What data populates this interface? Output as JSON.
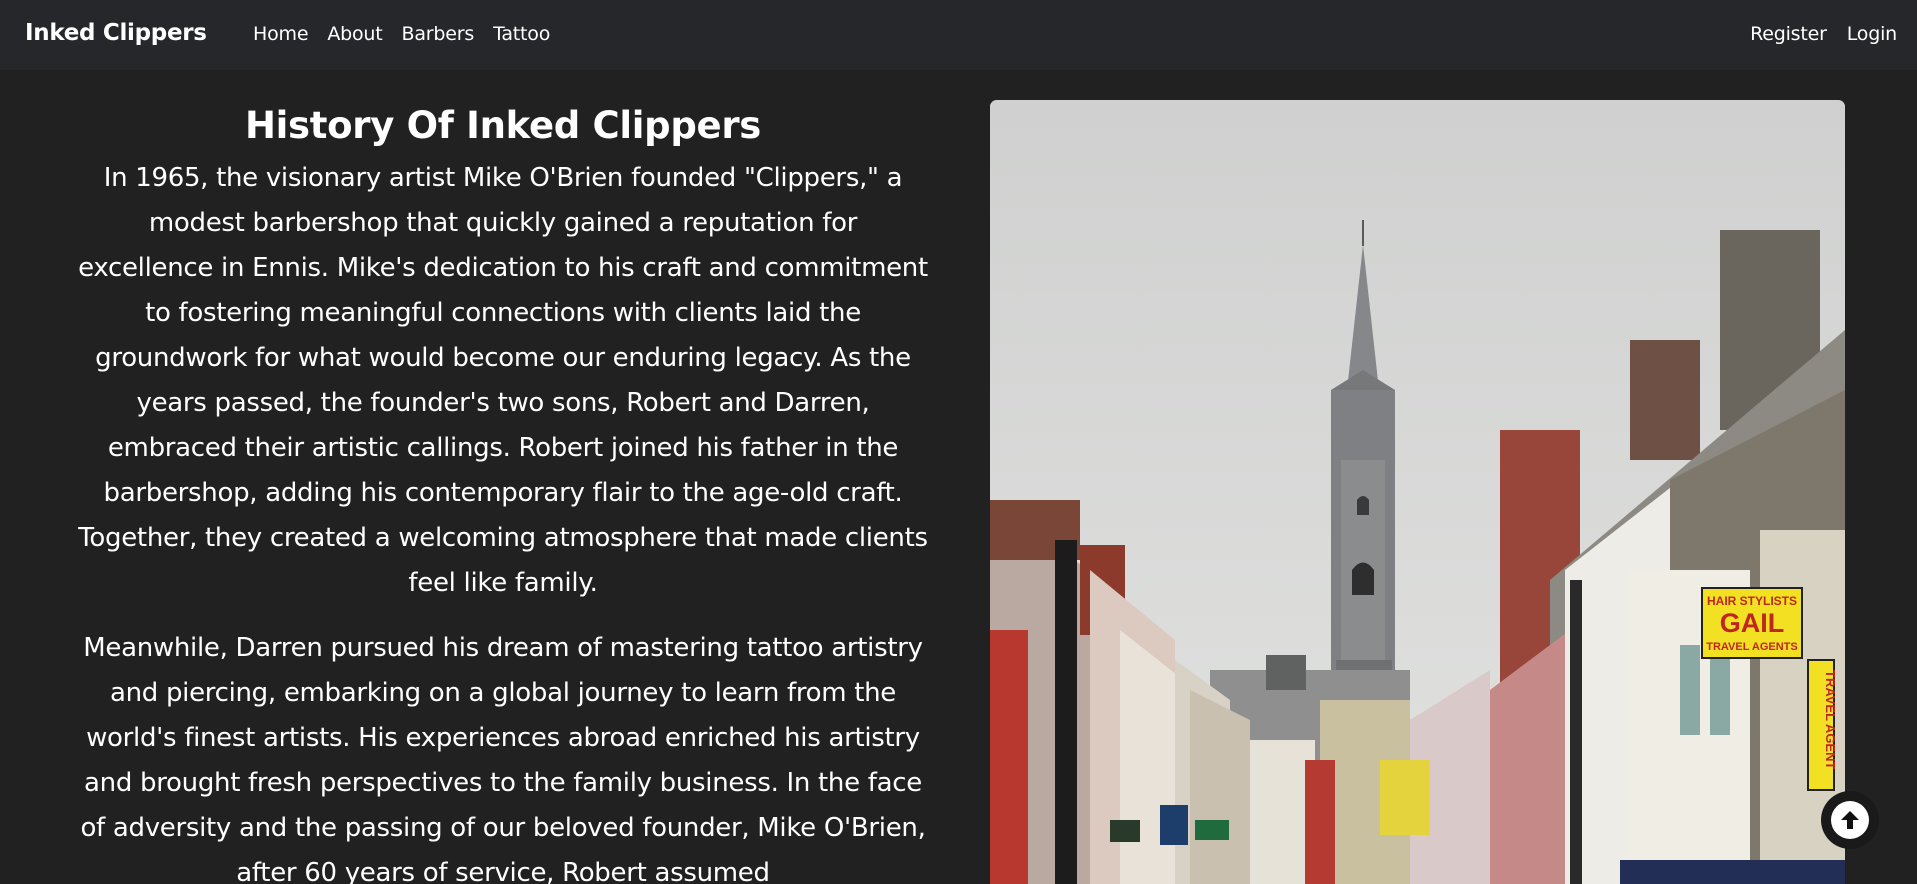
{
  "navbar": {
    "brand": "Inked Clippers",
    "links": [
      "Home",
      "About",
      "Barbers",
      "Tattoo"
    ],
    "auth": [
      "Register",
      "Login"
    ]
  },
  "history": {
    "title": "History Of Inked Clippers",
    "paragraph1": "In 1965, the visionary artist Mike O'Brien founded \"Clippers,\" a modest barbershop that quickly gained a reputation for excellence in Ennis. Mike's dedication to his craft and commitment to fostering meaningful connections with clients laid the groundwork for what would become our enduring legacy. As the years passed, the founder's two sons, Robert and Darren, embraced their artistic callings. Robert joined his father in the barbershop, adding his contemporary flair to the age-old craft. Together, they created a welcoming atmosphere that made clients feel like family.",
    "paragraph2": "Meanwhile, Darren pursued his dream of mastering tattoo artistry and piercing, embarking on a global journey to learn from the world's finest artists. His experiences abroad enriched his artistry and brought fresh perspectives to the family business. In the face of adversity and the passing of our beloved founder, Mike O'Brien, after 60 years of service, Robert assumed"
  },
  "photo": {
    "signs": {
      "hair_stylists": "HAIR STYLISTS",
      "gail": "GAIL",
      "travel_agents": "TRAVEL AGENTS",
      "travel_agent_vertical": "TRAVEL AGENT"
    }
  },
  "icons": {
    "scroll_top": "arrow-up-circle-icon"
  },
  "colors": {
    "background": "#212121",
    "navbar": "#25272a",
    "text": "#ffffff"
  }
}
